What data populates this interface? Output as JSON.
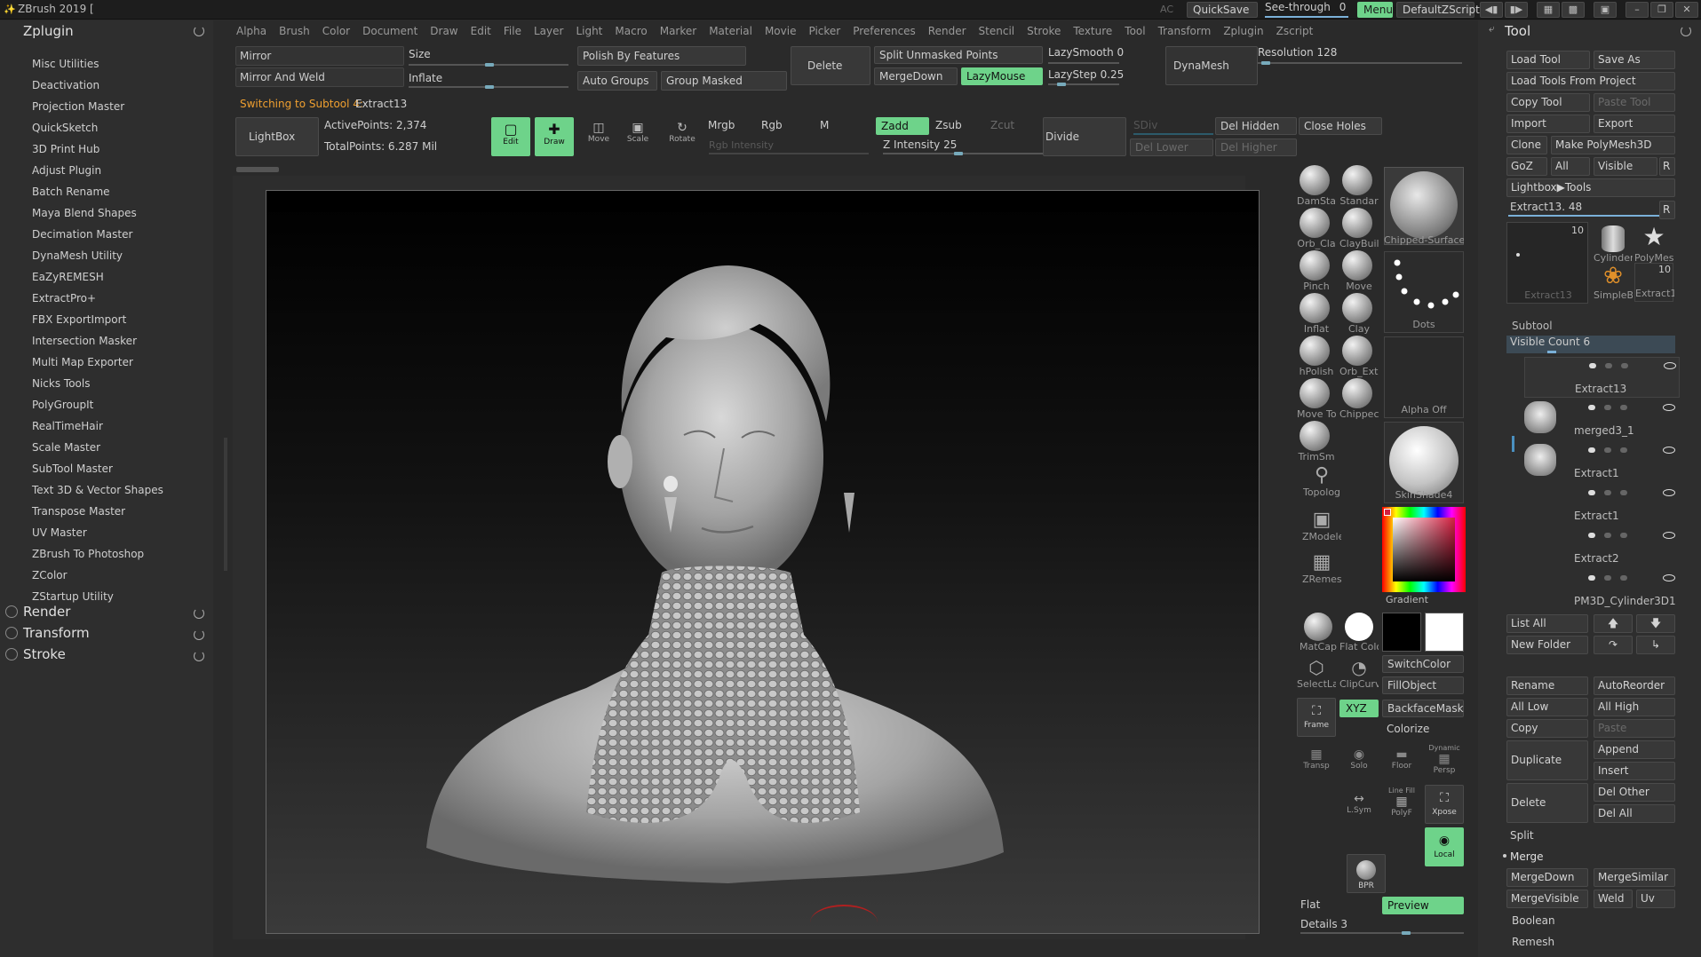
{
  "titlebar": {
    "title": "ZBrush 2019 [",
    "ac": "AC",
    "quicksave": "QuickSave",
    "see_through_label": "See-through",
    "see_through_value": "0",
    "menus": "Menus",
    "default_zscript": "DefaultZScript"
  },
  "left_panel": {
    "header": "Zplugin",
    "items": [
      "Misc Utilities",
      "Deactivation",
      "Projection Master",
      "QuickSketch",
      "3D Print Hub",
      "Adjust Plugin",
      "Batch Rename",
      "Maya Blend Shapes",
      "Decimation Master",
      "DynaMesh Utility",
      "EaZyREMESH",
      "ExtractPro+",
      "FBX ExportImport",
      "Intersection Masker",
      "Multi Map Exporter",
      "Nicks Tools",
      "PolyGroupIt",
      "RealTimeHair",
      "Scale Master",
      "SubTool Master",
      "Text 3D & Vector Shapes",
      "Transpose Master",
      "UV Master",
      "ZBrush To Photoshop",
      "ZColor",
      "ZStartup Utility"
    ],
    "sections": [
      "Render",
      "Transform",
      "Stroke"
    ]
  },
  "menubar": [
    "Alpha",
    "Brush",
    "Color",
    "Document",
    "Draw",
    "Edit",
    "File",
    "Layer",
    "Light",
    "Macro",
    "Marker",
    "Material",
    "Movie",
    "Picker",
    "Preferences",
    "Render",
    "Stencil",
    "Stroke",
    "Texture",
    "Tool",
    "Transform",
    "Zplugin",
    "Zscript"
  ],
  "toolbar": {
    "mirror": "Mirror",
    "mirror_and_weld": "Mirror And Weld",
    "size_label": "Size",
    "inflate_label": "Inflate",
    "polish_by_features": "Polish By Features",
    "auto_groups": "Auto Groups",
    "group_masked": "Group Masked",
    "delete": "Delete",
    "split_unmasked_points": "Split Unmasked Points",
    "merge_down": "MergeDown",
    "lazy_mouse": "LazyMouse",
    "lazy_smooth": "LazySmooth 0",
    "lazy_step": "LazyStep 0.25",
    "dynamesh": "DynaMesh",
    "resolution": "Resolution 128",
    "switching_label": "Switching to Subtool 4:",
    "switching_value": "Extract13",
    "lightbox": "LightBox",
    "active_points": "ActivePoints: 2,374",
    "total_points": "TotalPoints: 6.287 Mil",
    "edit": "Edit",
    "draw": "Draw",
    "move": "Move",
    "scale": "Scale",
    "rotate": "Rotate",
    "mrgb": "Mrgb",
    "rgb": "Rgb",
    "m": "M",
    "rgb_intensity": "Rgb Intensity",
    "zadd": "Zadd",
    "zsub": "Zsub",
    "zcut": "Zcut",
    "z_intensity": "Z Intensity 25",
    "divide": "Divide",
    "sdiv": "SDiv",
    "del_lower": "Del Lower",
    "del_higher": "Del Higher",
    "del_hidden": "Del Hidden",
    "close_holes": "Close Holes"
  },
  "shelf": {
    "brushes": [
      "DamSta",
      "Standar",
      "Orb_Cla",
      "ClayBuil",
      "Pinch",
      "Move",
      "Inflat",
      "Clay",
      "hPolish",
      "Orb_Extr",
      "Move To",
      "Chippec",
      "TrimSm"
    ],
    "chipped_surface": "Chipped-Surface",
    "dots": "Dots",
    "alpha_off": "Alpha Off",
    "skinshade": "SkinShade4",
    "topology": "Topolog",
    "zmodeler": "ZModele",
    "zremesher": "ZRemes",
    "gradient": "Gradient",
    "matcap": "MatCap",
    "flat_color": "Flat Colo",
    "switch_color": "SwitchColor",
    "fill_object": "FillObject",
    "select_lasso": "SelectLa",
    "clip_curve": "ClipCurv",
    "xyz": "XYZ",
    "backface_mask": "BackfaceMask",
    "colorize": "Colorize",
    "frame": "Frame",
    "transp": "Transp",
    "solo": "Solo",
    "dynamic": "Dynamic",
    "floor": "Floor",
    "persp": "Persp",
    "lsym": "L.Sym",
    "line_fill": "Line Fill",
    "polyf": "PolyF",
    "xpose": "Xpose",
    "local": "Local",
    "bpr": "BPR",
    "flat": "Flat",
    "preview": "Preview",
    "details": "Details 3"
  },
  "right_panel": {
    "header": "Tool",
    "load_tool": "Load Tool",
    "save_as": "Save As",
    "load_tools_from_project": "Load Tools From Project",
    "copy_tool": "Copy Tool",
    "paste_tool": "Paste Tool",
    "import": "Import",
    "export": "Export",
    "clone": "Clone",
    "make_polymesh": "Make PolyMesh3D",
    "goz": "GoZ",
    "all": "All",
    "visible": "Visible",
    "r": "R",
    "lightbox_tools": "Lightbox▶Tools",
    "extract_slider": "Extract13. 48",
    "thumb_count": "10",
    "thumb_names": [
      "Extract13",
      "Cylinder",
      "PolyMes",
      "SimpleB",
      "Extract1"
    ],
    "thumb_count2": "10",
    "subtool_label": "Subtool",
    "visible_count": "Visible Count 6",
    "subtools": [
      "Extract13",
      "merged3_1",
      "Extract1",
      "Extract1",
      "Extract2",
      "PM3D_Cylinder3D1"
    ],
    "list_all": "List All",
    "new_folder": "New Folder",
    "rename": "Rename",
    "auto_reorder": "AutoReorder",
    "all_low": "All Low",
    "all_high": "All High",
    "copy": "Copy",
    "paste": "Paste",
    "duplicate": "Duplicate",
    "append": "Append",
    "insert": "Insert",
    "delete": "Delete",
    "del_other": "Del Other",
    "del_all": "Del All",
    "split": "Split",
    "merge": "Merge",
    "merge_down": "MergeDown",
    "merge_similar": "MergeSimilar",
    "merge_visible": "MergeVisible",
    "weld": "Weld",
    "uv": "Uv",
    "boolean": "Boolean",
    "remesh": "Remesh"
  }
}
